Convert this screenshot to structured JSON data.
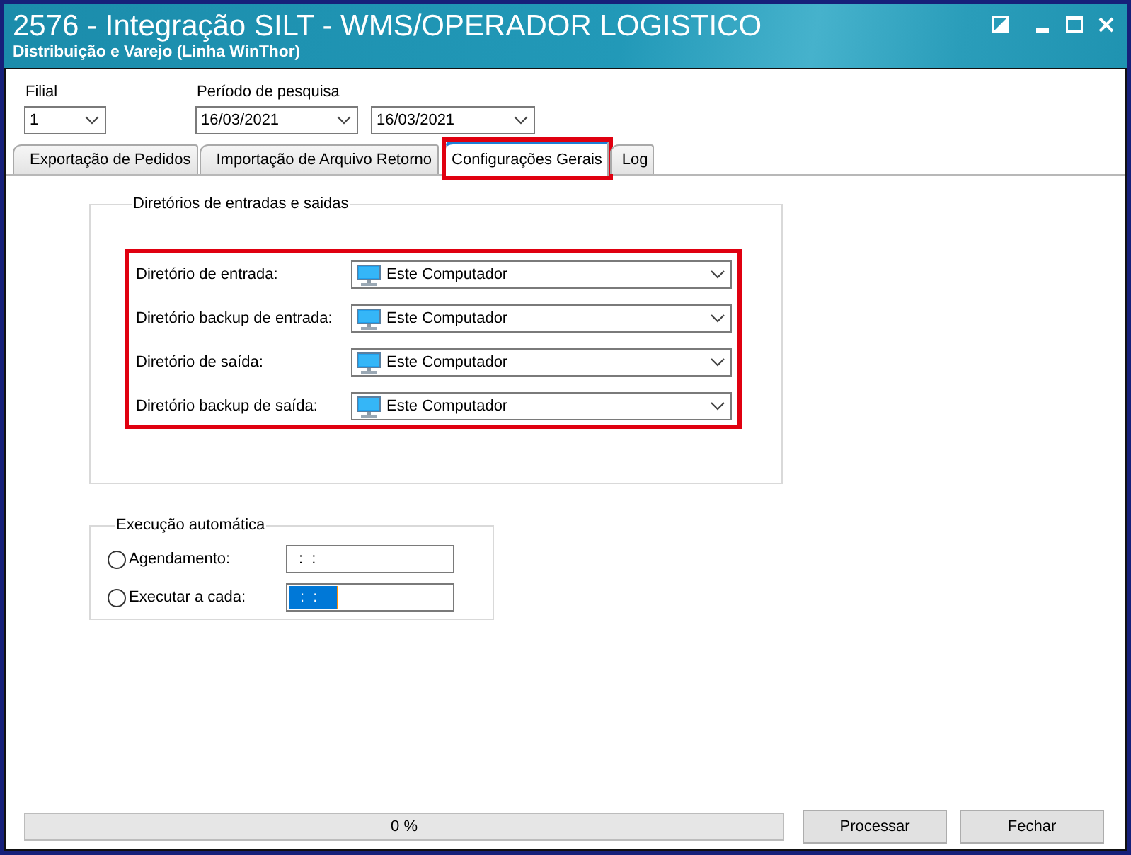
{
  "window": {
    "title": "2576 - Integração SILT - WMS/OPERADOR LOGISTICO",
    "subtitle": "Distribuição e Varejo (Linha WinThor)"
  },
  "filters": {
    "branch": {
      "label": "Filial",
      "value": "1"
    },
    "period": {
      "label": "Período de pesquisa",
      "start": "16/03/2021",
      "end": "16/03/2021"
    }
  },
  "tabs": [
    {
      "label": "Exportação de Pedidos",
      "selected": false,
      "highlighted": false
    },
    {
      "label": "Importação de Arquivo Retorno",
      "selected": false,
      "highlighted": false
    },
    {
      "label": "Configurações Gerais",
      "selected": true,
      "highlighted": true
    },
    {
      "label": "Log",
      "selected": false,
      "highlighted": false
    }
  ],
  "directories": {
    "title": "Diretórios de entradas e saidas",
    "highlighted": true,
    "rows": [
      {
        "label": "Diretório de entrada:",
        "value": "Este Computador"
      },
      {
        "label": "Diretório backup de entrada:",
        "value": "Este Computador"
      },
      {
        "label": "Diretório de saída:",
        "value": "Este Computador"
      },
      {
        "label": "Diretório backup de saída:",
        "value": "Este Computador"
      }
    ]
  },
  "auto_run": {
    "title": "Execução automática",
    "options": [
      {
        "label": "Agendamento:",
        "selected": false,
        "value": ":  :",
        "text_selected": false
      },
      {
        "label": "Executar a cada:",
        "selected": false,
        "value": ":  :",
        "text_selected": true
      }
    ]
  },
  "progress": {
    "reading": "0 %"
  },
  "buttons": [
    "Processar",
    "Fechar"
  ]
}
